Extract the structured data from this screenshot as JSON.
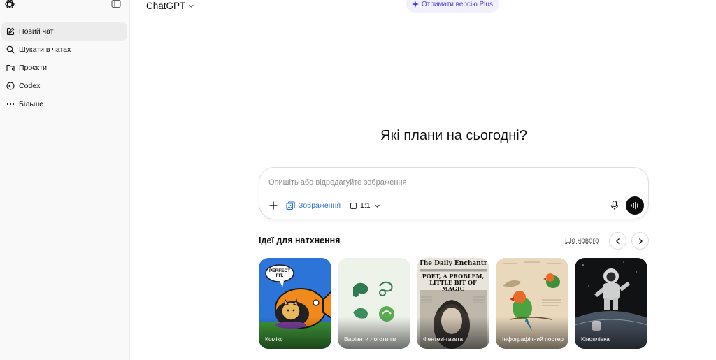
{
  "sidebar": {
    "items": [
      {
        "label": "Новий чат",
        "icon": "new-chat-icon"
      },
      {
        "label": "Шукати в чатах",
        "icon": "search-icon"
      },
      {
        "label": "Проєкти",
        "icon": "folder-icon"
      },
      {
        "label": "Codex",
        "icon": "codex-icon"
      },
      {
        "label": "Більше",
        "icon": "more-icon"
      }
    ]
  },
  "header": {
    "model": "ChatGPT",
    "upgrade_label": "Отримати версію Plus"
  },
  "main": {
    "headline": "Які плани на сьогодні?",
    "composer": {
      "placeholder": "Опишіть або відредагуйте зображення",
      "image_label": "Зображення",
      "ratio_label": "1:1"
    },
    "inspiration": {
      "title": "Ідеї для натхнення",
      "whats_new": "Що нового",
      "cards": [
        {
          "label": "Комікс",
          "speech_text": "PERFECT FIT."
        },
        {
          "label": "Варіанти логотипів"
        },
        {
          "label": "Фентезі-газета",
          "masthead": "The Daily Enchantress",
          "headline": "POET, A PROBLEM, LITTLE BIT OF MAGIC"
        },
        {
          "label": "Інфографічний постер"
        },
        {
          "label": "Кіноплівка"
        }
      ]
    }
  },
  "colors": {
    "accent_blue": "#2970c9",
    "upgrade_purple": "#4b3fd4",
    "sidebar_bg": "#f9f9f9"
  }
}
